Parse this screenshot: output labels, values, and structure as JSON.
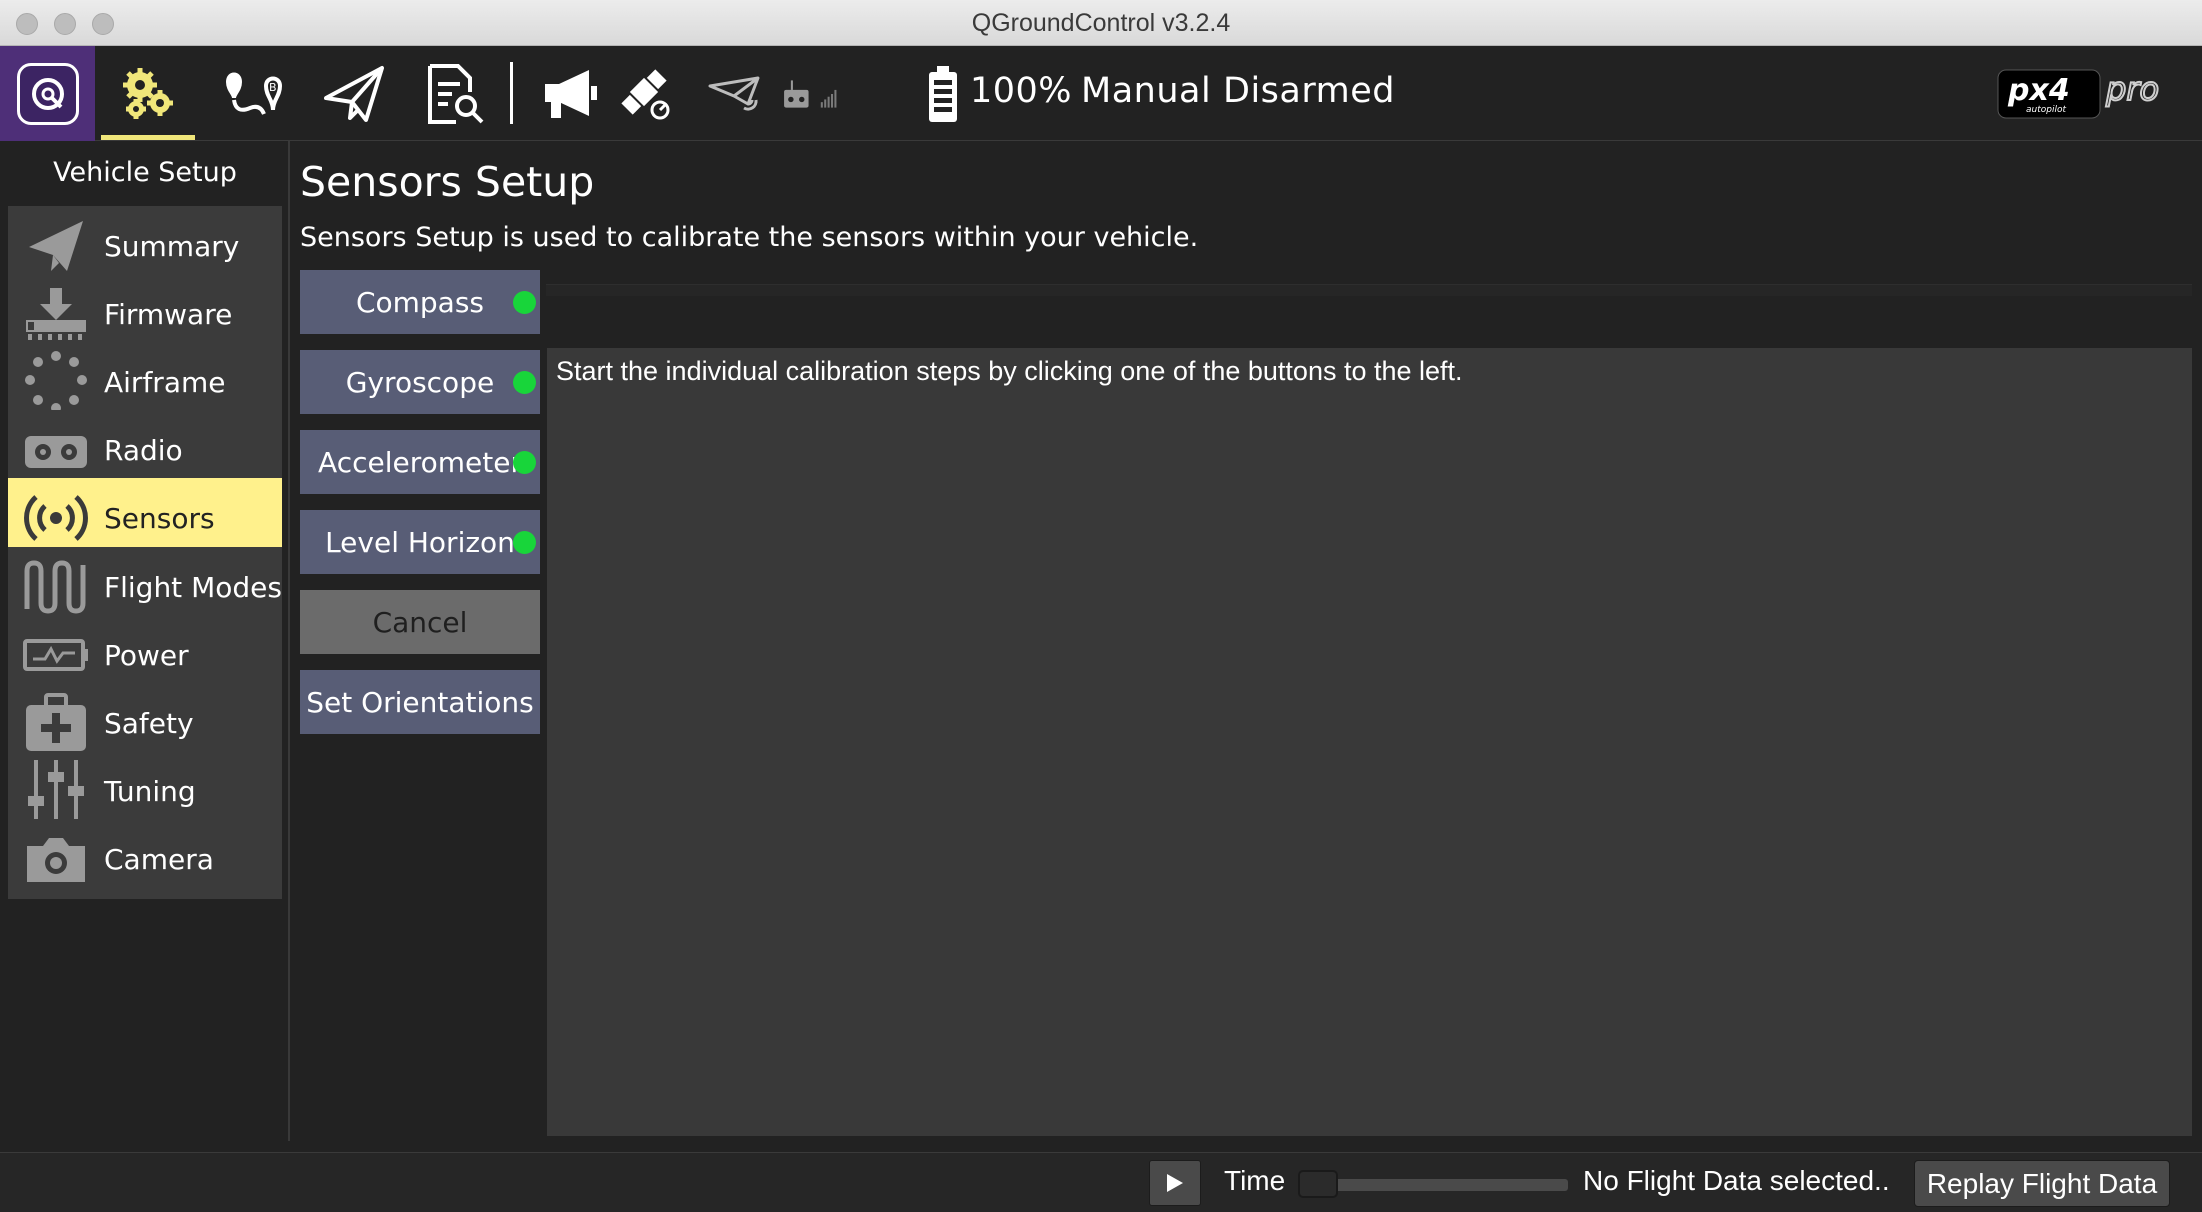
{
  "window": {
    "title": "QGroundControl v3.2.4"
  },
  "toolbar": {
    "battery_percent": "100%",
    "flight_mode": "Manual",
    "arm_state": "Disarmed",
    "brand_logo_text": "px4 autopilot pro",
    "icons": [
      "qgc-logo-icon",
      "vehicle-setup-gears-icon",
      "plan-view-icon",
      "fly-view-icon",
      "analyze-view-icon",
      "messages-megaphone-icon",
      "gps-satellite-icon",
      "telemetry-rssi-icon",
      "rc-rssi-icon",
      "battery-icon"
    ],
    "active_color": "#f0e67a"
  },
  "sidebar": {
    "title": "Vehicle Setup",
    "items": [
      {
        "label": "Summary",
        "icon": "paper-plane-icon"
      },
      {
        "label": "Firmware",
        "icon": "download-icon"
      },
      {
        "label": "Airframe",
        "icon": "airframe-dots-icon"
      },
      {
        "label": "Radio",
        "icon": "radio-transmitter-icon"
      },
      {
        "label": "Sensors",
        "icon": "sensors-broadcast-icon",
        "active": true
      },
      {
        "label": "Flight Modes",
        "icon": "flight-modes-wave-icon"
      },
      {
        "label": "Power",
        "icon": "power-battery-icon"
      },
      {
        "label": "Safety",
        "icon": "safety-kit-icon"
      },
      {
        "label": "Tuning",
        "icon": "tuning-sliders-icon"
      },
      {
        "label": "Camera",
        "icon": "camera-icon"
      }
    ]
  },
  "main": {
    "title": "Sensors Setup",
    "description": "Sensors Setup is used to calibrate the sensors within your vehicle.",
    "calibration_buttons": [
      {
        "label": "Compass",
        "status": "calibrated"
      },
      {
        "label": "Gyroscope",
        "status": "calibrated"
      },
      {
        "label": "Accelerometer",
        "status": "calibrated"
      },
      {
        "label": "Level Horizon",
        "status": "calibrated"
      },
      {
        "label": "Cancel"
      },
      {
        "label": "Set Orientations"
      }
    ],
    "instructions": "Start the individual calibration steps by clicking one of the buttons to the left.",
    "status_color": "#18d53a"
  },
  "bottombar": {
    "time_label": "Time",
    "replay_progress": 0,
    "status": "No Flight Data selected..",
    "replay_button": "Replay Flight Data"
  }
}
